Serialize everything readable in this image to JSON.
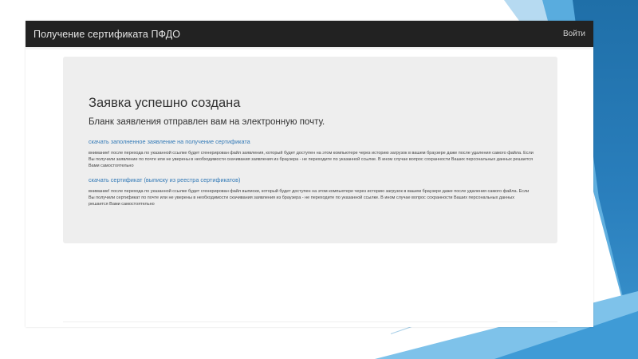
{
  "navbar": {
    "brand": "Получение сертификата ПФДО",
    "login": "Войти"
  },
  "content": {
    "title": "Заявка успешно создана",
    "subtitle": "Бланк заявления отправлен вам на электронную почту.",
    "link_application": "скачать заполненное заявление на получение сертификата",
    "note_application": "внимание! после перехода по указанной ссылке будет сгенерирован файл заявления, который будет доступен на этом компьютере через историю загрузок в вашем браузере даже после удаления самого файла. Если Вы получили заявление по почте или не уверены в необходимости скачивания заявления из браузера - не переходите по указанной ссылке. В ином случае вопрос сохранности Ваших персональных данных решается Вами самостоятельно",
    "link_certificate": "скачать сертификат (выписку из реестра сертификатов)",
    "note_certificate": "внимание! после перехода по указанной ссылке будет сгенерирован файл выписки, который будет доступен на этом компьютере через историю загрузок в вашем браузере даже после удаления самого файла. Если Вы получили сертификат по почте или не уверены в необходимости скачивания заявления из браузера - не переходите по указанной ссылке. В ином случае вопрос сохранности Ваших персональных данных решается Вами самостоятельно"
  },
  "colors": {
    "navbar_bg": "#222222",
    "panel_bg": "#eeeeee",
    "link": "#337ab7",
    "deco_blue_dark": "#1f6fa8",
    "deco_blue_light": "#7ec2ea"
  }
}
